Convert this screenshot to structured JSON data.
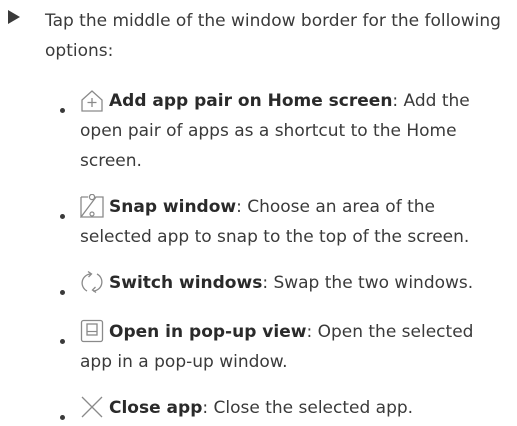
{
  "intro": "Tap the middle of the window border for the following options:",
  "options": [
    {
      "icon": "add-home-icon",
      "title": "Add app pair on Home screen",
      "desc": ": Add the open pair of apps as a shortcut to the Home screen."
    },
    {
      "icon": "snap-window-icon",
      "title": "Snap window",
      "desc": ": Choose an area of the selected app to snap to the top of the screen."
    },
    {
      "icon": "switch-windows-icon",
      "title": "Switch windows",
      "desc": ": Swap the two windows."
    },
    {
      "icon": "popup-view-icon",
      "title": "Open in pop-up view",
      "desc": ": Open the selected app in a pop-up window."
    },
    {
      "icon": "close-icon",
      "title": "Close app",
      "desc": ": Close the selected app."
    }
  ],
  "colors": {
    "text": "#3a3a3a",
    "icon": "#8a8a8a"
  }
}
